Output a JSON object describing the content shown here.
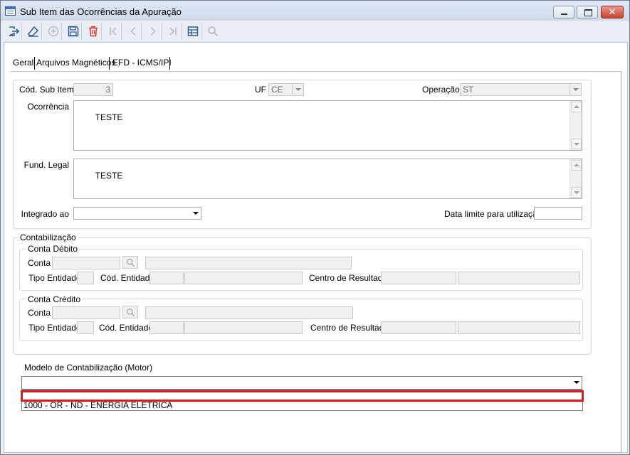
{
  "window": {
    "title": "Sub Item das Ocorrências da Apuração",
    "close_glyph": "✕"
  },
  "toolbar": {
    "buttons": [
      {
        "name": "exit-icon"
      },
      {
        "name": "eraser-icon"
      },
      {
        "name": "add-icon"
      },
      {
        "name": "save-icon"
      },
      {
        "name": "delete-icon"
      },
      {
        "name": "first-record-icon"
      },
      {
        "name": "previous-record-icon"
      },
      {
        "name": "next-record-icon"
      },
      {
        "name": "last-record-icon"
      },
      {
        "name": "grid-view-icon"
      },
      {
        "name": "search-icon"
      }
    ]
  },
  "tabs": [
    {
      "label": "Geral"
    },
    {
      "label": "Arquivos Magnéticos"
    },
    {
      "label": "EFD - ICMS/IPI"
    }
  ],
  "general": {
    "cod_sub_item_label": "Cód. Sub Item",
    "cod_sub_item_value": "3",
    "uf_label": "UF",
    "uf_value": "CE",
    "operacao_label": "Operação",
    "operacao_value": "ST",
    "ocorrencia_label": "Ocorrência",
    "ocorrencia_value": "TESTE",
    "fund_legal_label": "Fund. Legal",
    "fund_legal_value": "TESTE",
    "integrado_label": "Integrado ao",
    "integrado_value": "",
    "data_limite_label": "Data limite para utilização:",
    "data_limite_value": ""
  },
  "contabilizacao": {
    "label": "Contabilização",
    "debito": {
      "label": "Conta Débito",
      "conta_label": "Conta",
      "tipo_entidade_label": "Tipo Entidade",
      "cod_entidade_label": "Cód. Entidade",
      "centro_resultado_label": "Centro de Resultado"
    },
    "credito": {
      "label": "Conta Crédito",
      "conta_label": "Conta",
      "tipo_entidade_label": "Tipo Entidade",
      "cod_entidade_label": "Cód. Entidade",
      "centro_resultado_label": "Centro de Resultado"
    }
  },
  "modelo": {
    "label": "Modelo de Contabilização (Motor)",
    "value": "",
    "options": [
      "",
      "1000 - OR - ND - ENERGIA ELETRICA"
    ]
  },
  "colors": {
    "highlight": "#e3161d",
    "delete_icon": "#d9342b",
    "accent": "#2f5a8f"
  }
}
